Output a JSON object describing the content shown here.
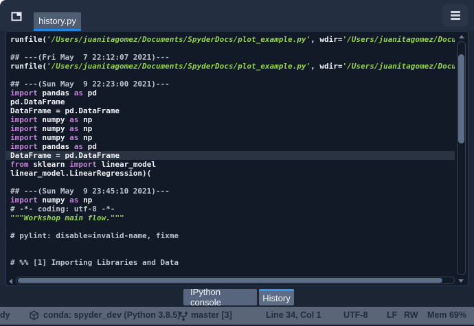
{
  "top_bar": {
    "tab_label": "history.py",
    "accent_underline_color": "#1f87e8"
  },
  "editor": {
    "lines": [
      {
        "hl": false,
        "segs": [
          {
            "t": "runfile(",
            "c": "p"
          },
          {
            "t": "'/Users/juanitagomez/Documents/SpyderDocs/plot_example.py'",
            "c": "s"
          },
          {
            "t": ", wdir=",
            "c": "p"
          },
          {
            "t": "'/Users/juanitagomez/Docum",
            "c": "s"
          }
        ]
      },
      {
        "hl": false,
        "segs": []
      },
      {
        "hl": false,
        "segs": [
          {
            "t": "## ---(Fri May  7 22:12:07 2021)---",
            "c": "c"
          }
        ]
      },
      {
        "hl": false,
        "segs": [
          {
            "t": "runfile(",
            "c": "p"
          },
          {
            "t": "'/Users/juanitagomez/Documents/SpyderDocs/plot_example.py'",
            "c": "s"
          },
          {
            "t": ", wdir=",
            "c": "p"
          },
          {
            "t": "'/Users/juanitagomez/Docum",
            "c": "s"
          }
        ]
      },
      {
        "hl": false,
        "segs": []
      },
      {
        "hl": false,
        "segs": [
          {
            "t": "## ---(Sun May  9 22:23:00 2021)---",
            "c": "c"
          }
        ]
      },
      {
        "hl": false,
        "segs": [
          {
            "t": "import",
            "c": "k"
          },
          {
            "t": " pandas ",
            "c": "p"
          },
          {
            "t": "as",
            "c": "k"
          },
          {
            "t": " pd",
            "c": "p"
          }
        ]
      },
      {
        "hl": false,
        "segs": [
          {
            "t": "pd.DataFrame",
            "c": "p"
          }
        ]
      },
      {
        "hl": false,
        "segs": [
          {
            "t": "DataFrame = pd.DataFrame",
            "c": "p"
          }
        ]
      },
      {
        "hl": false,
        "segs": [
          {
            "t": "import",
            "c": "k"
          },
          {
            "t": " numpy ",
            "c": "p"
          },
          {
            "t": "as",
            "c": "k"
          },
          {
            "t": " np",
            "c": "p"
          }
        ]
      },
      {
        "hl": false,
        "segs": [
          {
            "t": "import",
            "c": "k"
          },
          {
            "t": " numpy ",
            "c": "p"
          },
          {
            "t": "as",
            "c": "k"
          },
          {
            "t": " np",
            "c": "p"
          }
        ]
      },
      {
        "hl": false,
        "segs": [
          {
            "t": "import",
            "c": "k"
          },
          {
            "t": " numpy ",
            "c": "p"
          },
          {
            "t": "as",
            "c": "k"
          },
          {
            "t": " np",
            "c": "p"
          }
        ]
      },
      {
        "hl": false,
        "segs": [
          {
            "t": "import",
            "c": "k"
          },
          {
            "t": " pandas ",
            "c": "p"
          },
          {
            "t": "as",
            "c": "k"
          },
          {
            "t": " pd",
            "c": "p"
          }
        ]
      },
      {
        "hl": true,
        "segs": [
          {
            "t": "DataFrame = pd.DataFrame",
            "c": "p"
          }
        ]
      },
      {
        "hl": false,
        "segs": [
          {
            "t": "from",
            "c": "k"
          },
          {
            "t": " sklearn ",
            "c": "p"
          },
          {
            "t": "import",
            "c": "k"
          },
          {
            "t": " linear_model",
            "c": "p"
          }
        ]
      },
      {
        "hl": false,
        "segs": [
          {
            "t": "linear_model.LinearRegression)(",
            "c": "p"
          }
        ]
      },
      {
        "hl": false,
        "segs": []
      },
      {
        "hl": false,
        "segs": [
          {
            "t": "## ---(Sun May  9 23:45:10 2021)---",
            "c": "c"
          }
        ]
      },
      {
        "hl": false,
        "segs": [
          {
            "t": "import",
            "c": "k"
          },
          {
            "t": " numpy ",
            "c": "p"
          },
          {
            "t": "as",
            "c": "k"
          },
          {
            "t": " np",
            "c": "p"
          }
        ]
      },
      {
        "hl": false,
        "segs": [
          {
            "t": "# -*- coding: utf-8 -*-",
            "c": "c"
          }
        ]
      },
      {
        "hl": false,
        "segs": [
          {
            "t": "\"\"\"Workshop main flow.\"\"\"",
            "c": "s"
          }
        ]
      },
      {
        "hl": false,
        "segs": []
      },
      {
        "hl": false,
        "segs": [
          {
            "t": "# pylint: disable=invalid-name, fixme",
            "c": "c"
          }
        ]
      },
      {
        "hl": false,
        "segs": []
      },
      {
        "hl": false,
        "segs": []
      },
      {
        "hl": false,
        "segs": [
          {
            "t": "# %% [1] Importing Libraries and Data",
            "c": "c"
          }
        ]
      }
    ],
    "syntax_colors": {
      "plain": "#eef1f6",
      "keyword": "#c47fd8",
      "string": "#93d14e",
      "comment": "#bcc3cd",
      "highlight_bg": "#2a3342",
      "background": "#131a27"
    }
  },
  "bottom_tabs": [
    {
      "label": "IPython console",
      "active": false
    },
    {
      "label": "History",
      "active": true
    }
  ],
  "status_bar": {
    "left_partial": "dy",
    "conda": "conda: spyder_dev (Python 3.8.5)",
    "git_branch": "master [3]",
    "cursor": "Line 34, Col 1",
    "encoding": "UTF-8",
    "eol": "LF",
    "permissions": "RW",
    "memory": "Mem 69%"
  }
}
